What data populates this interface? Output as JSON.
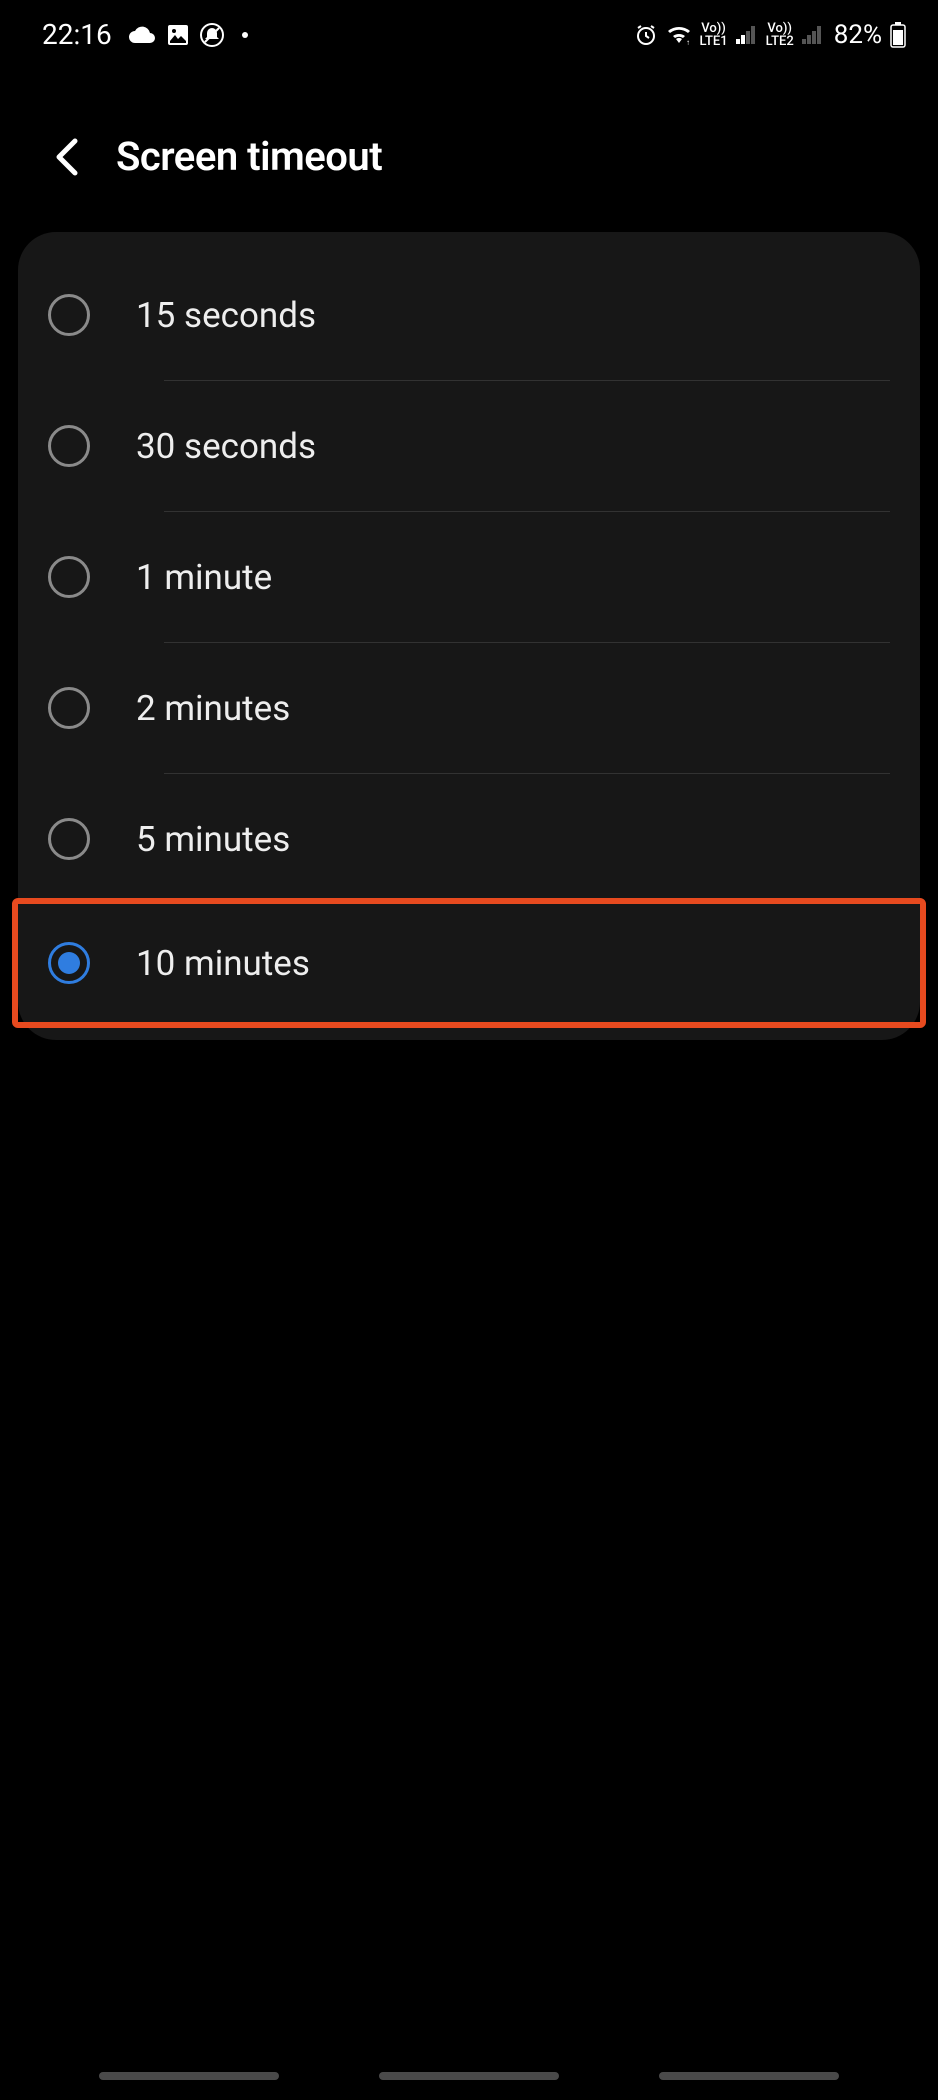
{
  "statusBar": {
    "time": "22:16",
    "batteryPercent": "82%",
    "lte1": "LTE1",
    "lte2": "LTE2",
    "vo1": "Vo))",
    "vo2": "Vo))"
  },
  "header": {
    "title": "Screen timeout"
  },
  "options": [
    {
      "label": "15 seconds",
      "selected": false,
      "highlighted": false
    },
    {
      "label": "30 seconds",
      "selected": false,
      "highlighted": false
    },
    {
      "label": "1 minute",
      "selected": false,
      "highlighted": false
    },
    {
      "label": "2 minutes",
      "selected": false,
      "highlighted": false
    },
    {
      "label": "5 minutes",
      "selected": false,
      "highlighted": false
    },
    {
      "label": "10 minutes",
      "selected": true,
      "highlighted": true
    }
  ]
}
